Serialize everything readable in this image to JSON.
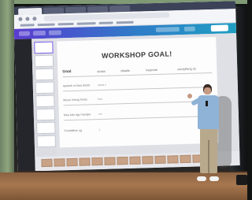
{
  "scene": "presentation-on-stage",
  "slide": {
    "title": "WORKSHOP GOAL!",
    "columns": [
      "Goal",
      "status",
      "details",
      "Keynote",
      "everything 2x"
    ],
    "rows": [
      {
        "label": "Apakah ini bisa ditulis",
        "value": "nama n"
      },
      {
        "label": "Mesin Voting Kelas",
        "value": "free"
      },
      {
        "label": "Mau kah ngy manajer",
        "value": "nm"
      },
      {
        "label": "Pendidikan yg",
        "value": "1"
      }
    ]
  },
  "colors": {
    "app_bar_start": "#5a3bd1",
    "app_bar_end": "#1f9fc2",
    "shirt": "#8fb3d6",
    "stage_floor": "#a7774f"
  }
}
